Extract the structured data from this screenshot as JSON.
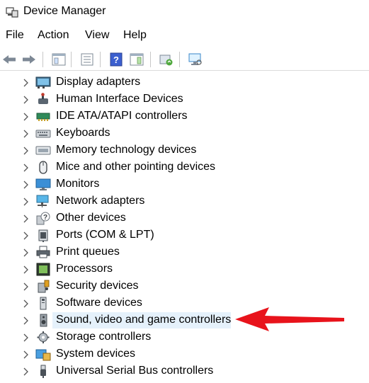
{
  "window": {
    "title": "Device Manager",
    "icon": "device-manager-icon"
  },
  "menu": [
    "File",
    "Action",
    "View",
    "Help"
  ],
  "toolbar": {
    "buttons": [
      "back-arrow-icon",
      "forward-arrow-icon",
      "show-hide-tree-icon",
      "properties-icon",
      "help-icon",
      "action-pane-icon",
      "update-driver-icon",
      "scan-hardware-icon"
    ]
  },
  "tree": {
    "items": [
      {
        "label": "Display adapters",
        "icon": "display-adapter-icon"
      },
      {
        "label": "Human Interface Devices",
        "icon": "hid-icon"
      },
      {
        "label": "IDE ATA/ATAPI controllers",
        "icon": "ide-controller-icon"
      },
      {
        "label": "Keyboards",
        "icon": "keyboard-icon"
      },
      {
        "label": "Memory technology devices",
        "icon": "memory-device-icon"
      },
      {
        "label": "Mice and other pointing devices",
        "icon": "mouse-icon"
      },
      {
        "label": "Monitors",
        "icon": "monitor-icon"
      },
      {
        "label": "Network adapters",
        "icon": "network-adapter-icon"
      },
      {
        "label": "Other devices",
        "icon": "other-devices-icon"
      },
      {
        "label": "Ports (COM & LPT)",
        "icon": "port-icon"
      },
      {
        "label": "Print queues",
        "icon": "printer-icon"
      },
      {
        "label": "Processors",
        "icon": "processor-icon"
      },
      {
        "label": "Security devices",
        "icon": "security-device-icon"
      },
      {
        "label": "Software devices",
        "icon": "software-device-icon"
      },
      {
        "label": "Sound, video and game controllers",
        "icon": "speaker-icon",
        "selected": true
      },
      {
        "label": "Storage controllers",
        "icon": "storage-controller-icon"
      },
      {
        "label": "System devices",
        "icon": "system-devices-icon"
      },
      {
        "label": "Universal Serial Bus controllers",
        "icon": "usb-icon"
      }
    ]
  },
  "colors": {
    "selection": "#e5f1fb",
    "annotation_arrow": "#e8131b"
  }
}
